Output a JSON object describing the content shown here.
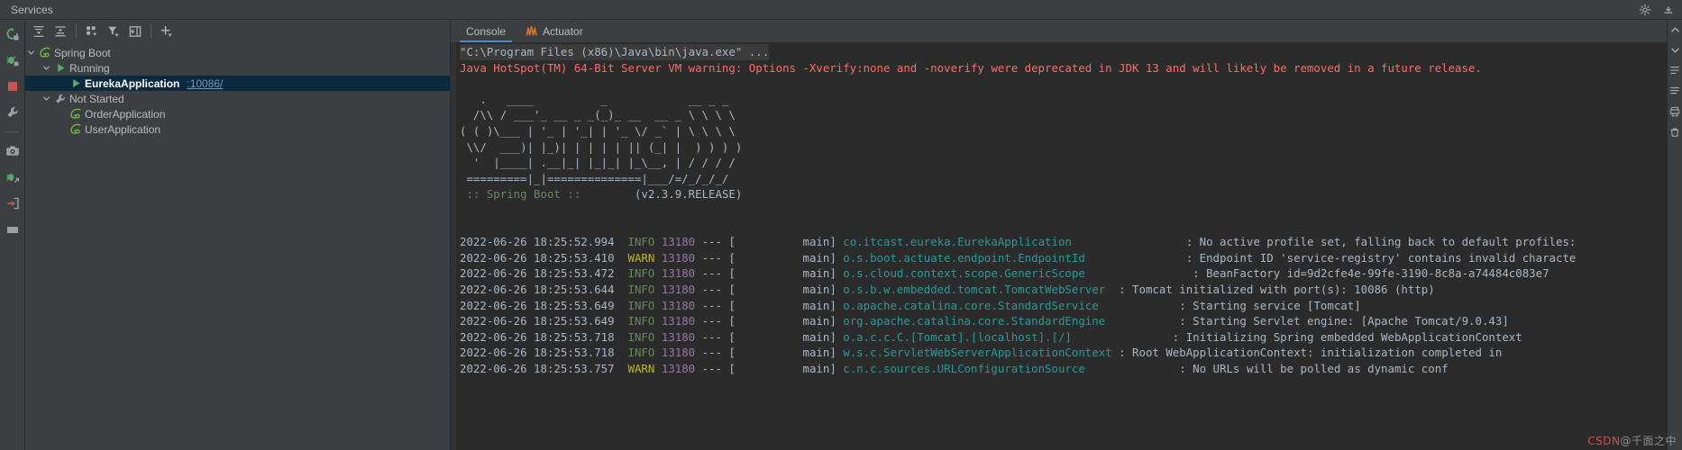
{
  "window": {
    "title": "Services",
    "settings_icon": "gear-icon",
    "hide_icon": "minimize-icon"
  },
  "rail": {
    "items": [
      {
        "name": "rerun-icon",
        "tooltip": "Rerun"
      },
      {
        "name": "debug-icon",
        "tooltip": "Debug"
      },
      {
        "name": "stop-icon",
        "tooltip": "Stop"
      },
      {
        "name": "settings-wrench-icon",
        "tooltip": "Edit Configuration"
      },
      {
        "name": "camera-icon",
        "tooltip": "Take Thread Dump"
      },
      {
        "name": "attach-debugger-icon",
        "tooltip": "Attach Debugger"
      },
      {
        "name": "exit-icon",
        "tooltip": "Exit"
      },
      {
        "name": "layout-icon",
        "tooltip": "Layout"
      }
    ]
  },
  "tree_toolbar": {
    "buttons": [
      {
        "name": "expand-all-button",
        "icon": "expand-all-icon"
      },
      {
        "name": "collapse-all-button",
        "icon": "collapse-all-icon"
      },
      {
        "name": "group-by-button",
        "icon": "group-by-icon"
      },
      {
        "name": "filter-button",
        "icon": "filter-icon"
      },
      {
        "name": "show-configurations-button",
        "icon": "add-frame-icon"
      },
      {
        "name": "add-service-button",
        "icon": "plus-icon"
      }
    ]
  },
  "tree": {
    "nodes": [
      {
        "level": 0,
        "expanded": true,
        "icon": "spring-boot-icon",
        "label": "Spring Boot",
        "selected": false,
        "bold": false
      },
      {
        "level": 1,
        "expanded": true,
        "icon": "run-green-icon",
        "label": "Running",
        "selected": false,
        "bold": false
      },
      {
        "level": 2,
        "expanded": false,
        "icon": "run-green-icon",
        "label": "EurekaApplication",
        "selected": true,
        "bold": true,
        "link": ":10086/"
      },
      {
        "level": 1,
        "expanded": true,
        "icon": "wrench-icon",
        "label": "Not Started",
        "selected": false,
        "bold": false
      },
      {
        "level": 2,
        "expanded": false,
        "icon": "spring-boot-icon",
        "label": "OrderApplication",
        "selected": false,
        "bold": false
      },
      {
        "level": 2,
        "expanded": false,
        "icon": "spring-boot-icon",
        "label": "UserApplication",
        "selected": false,
        "bold": false
      }
    ]
  },
  "tabs": [
    {
      "label": "Console",
      "icon": "",
      "active": true
    },
    {
      "label": "Actuator",
      "icon": "actuator-icon",
      "active": false
    }
  ],
  "console": {
    "command_line": "\"C:\\Program Files (x86)\\Java\\bin\\java.exe\" ...",
    "warning_line": "Java HotSpot(TM) 64-Bit Server VM warning: Options -Xverify:none and -noverify were deprecated in JDK 13 and will likely be removed in a future release.",
    "banner": [
      "   .   ____          _            __ _ _",
      "  /\\\\ / ___'_ __ _ _(_)_ __  __ _ \\ \\ \\ \\",
      "( ( )\\___ | '_ | '_| | '_ \\/ _` | \\ \\ \\ \\",
      " \\\\/  ___)| |_)| | | | | || (_| |  ) ) ) )",
      "  '  |____| .__|_| |_|_| |_\\__, | / / / /",
      " =========|_|==============|___/=/_/_/_/"
    ],
    "banner_version_prefix": " :: Spring Boot :: ",
    "banner_version": "       (v2.3.9.RELEASE)",
    "log_lines": [
      {
        "time": "2022-06-26 18:25:52.994",
        "level": "INFO",
        "pid": "13180",
        "thread": "main",
        "logger": "co.itcast.eureka.EurekaApplication",
        "message": "No active profile set, falling back to default profiles:"
      },
      {
        "time": "2022-06-26 18:25:53.410",
        "level": "WARN",
        "pid": "13180",
        "thread": "main",
        "logger": "o.s.boot.actuate.endpoint.EndpointId",
        "message": "Endpoint ID 'service-registry' contains invalid characte"
      },
      {
        "time": "2022-06-26 18:25:53.472",
        "level": "INFO",
        "pid": "13180",
        "thread": "main",
        "logger": "o.s.cloud.context.scope.GenericScope",
        "message": "BeanFactory id=9d2cfe4e-99fe-3190-8c8a-a74484c083e7"
      },
      {
        "time": "2022-06-26 18:25:53.644",
        "level": "INFO",
        "pid": "13180",
        "thread": "main",
        "logger": "o.s.b.w.embedded.tomcat.TomcatWebServer",
        "message": "Tomcat initialized with port(s): 10086 (http)"
      },
      {
        "time": "2022-06-26 18:25:53.649",
        "level": "INFO",
        "pid": "13180",
        "thread": "main",
        "logger": "o.apache.catalina.core.StandardService",
        "message": "Starting service [Tomcat]"
      },
      {
        "time": "2022-06-26 18:25:53.649",
        "level": "INFO",
        "pid": "13180",
        "thread": "main",
        "logger": "org.apache.catalina.core.StandardEngine",
        "message": "Starting Servlet engine: [Apache Tomcat/9.0.43]"
      },
      {
        "time": "2022-06-26 18:25:53.718",
        "level": "INFO",
        "pid": "13180",
        "thread": "main",
        "logger": "o.a.c.c.C.[Tomcat].[localhost].[/]",
        "message": "Initializing Spring embedded WebApplicationContext"
      },
      {
        "time": "2022-06-26 18:25:53.718",
        "level": "INFO",
        "pid": "13180",
        "thread": "main",
        "logger": "w.s.c.ServletWebServerApplicationContext",
        "message": "Root WebApplicationContext: initialization completed in"
      },
      {
        "time": "2022-06-26 18:25:53.757",
        "level": "WARN",
        "pid": "13180",
        "thread": "main",
        "logger": "c.n.c.sources.URLConfigurationSource",
        "message": "No URLs will be polled as dynamic conf"
      }
    ]
  },
  "watermark": {
    "prefix": "CSDN",
    "suffix": "@千面之中"
  },
  "colors": {
    "background": "#3c3f41",
    "console_bg": "#2b2b2b",
    "selection": "#0d293e",
    "link": "#6897bb",
    "info": "#6a8759",
    "warn": "#bbb529",
    "error": "#ff6b68",
    "logger": "#299999",
    "pid": "#9876aa",
    "accent": "#4a88c7",
    "green": "#59a869",
    "actuator": "#cc7832"
  }
}
